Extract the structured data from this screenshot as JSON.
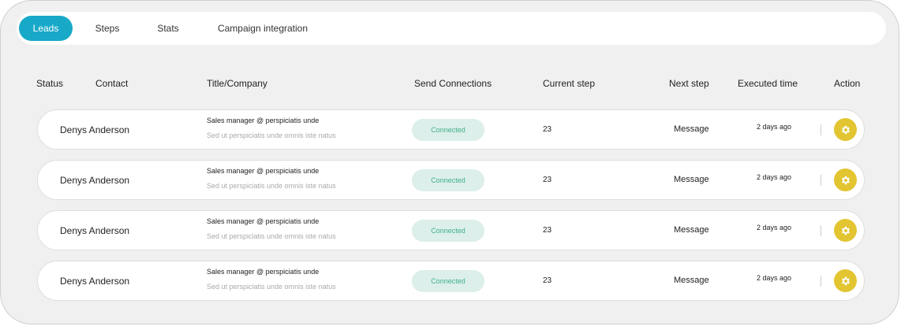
{
  "tabs": [
    {
      "label": "Leads",
      "active": true
    },
    {
      "label": "Steps",
      "active": false
    },
    {
      "label": "Stats",
      "active": false
    },
    {
      "label": "Campaign integration",
      "active": false
    }
  ],
  "table": {
    "headers": {
      "status": "Status",
      "contact": "Contact",
      "title_company": "Title/Company",
      "send_connections": "Send Connections",
      "current_step": "Current step",
      "next_step": "Next step",
      "executed_time": "Executed time",
      "action": "Action"
    },
    "rows": [
      {
        "contact": "Denys Anderson",
        "title": "Sales manager @  perspiciatis unde",
        "company": "Sed ut perspiciatis unde omnis iste natus",
        "status": "Connected",
        "current_step": "23",
        "next_step": "Message",
        "executed_time": "2 days ago",
        "action_icon": "gear-icon"
      },
      {
        "contact": "Denys Anderson",
        "title": "Sales manager @  perspiciatis unde",
        "company": "Sed ut perspiciatis unde omnis iste natus",
        "status": "Connected",
        "current_step": "23",
        "next_step": "Message",
        "executed_time": "2 days ago",
        "action_icon": "gear-icon"
      },
      {
        "contact": "Denys Anderson",
        "title": "Sales manager @  perspiciatis unde",
        "company": "Sed ut perspiciatis unde omnis iste natus",
        "status": "Connected",
        "current_step": "23",
        "next_step": "Message",
        "executed_time": "2 days ago",
        "action_icon": "gear-icon"
      },
      {
        "contact": "Denys Anderson",
        "title": "Sales manager @  perspiciatis unde",
        "company": "Sed ut perspiciatis unde omnis iste natus",
        "status": "Connected",
        "current_step": "23",
        "next_step": "Message",
        "executed_time": "2 days ago",
        "action_icon": "gear-icon"
      }
    ]
  },
  "colors": {
    "accent": "#18a9c8",
    "connected_bg": "#dcefea",
    "connected_text": "#3fb08a",
    "action_button": "#e2c531"
  }
}
